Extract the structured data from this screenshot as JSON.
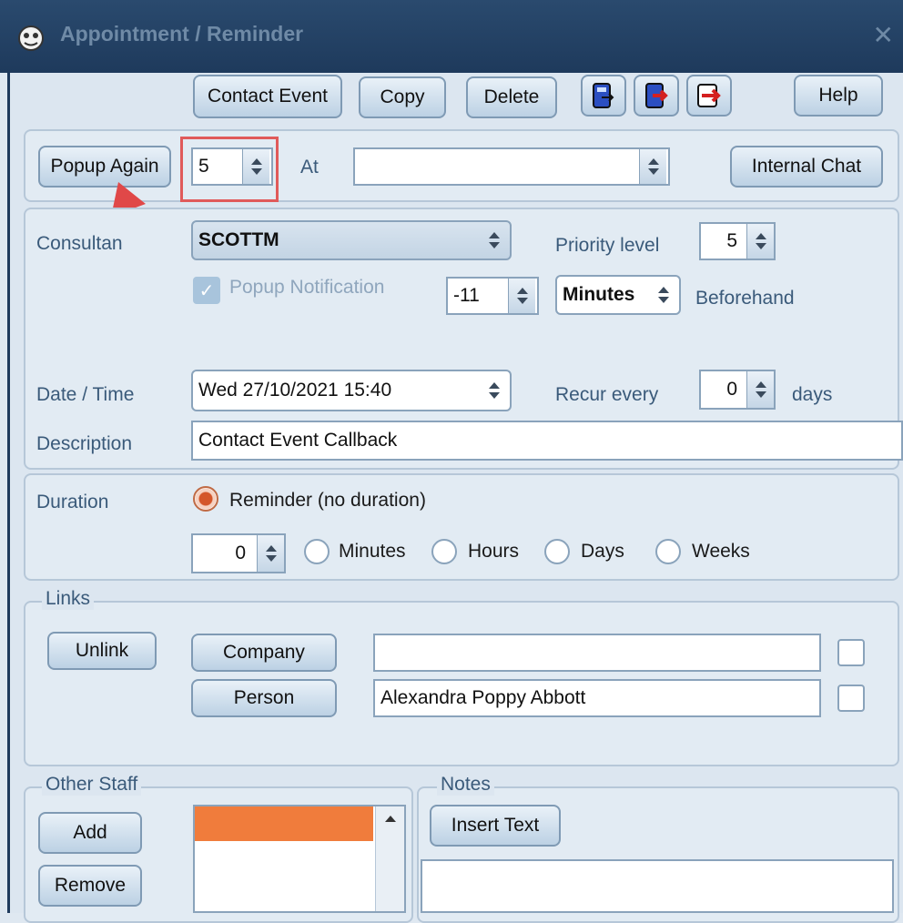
{
  "window": {
    "title": "Appointment / Reminder"
  },
  "toolbar": {
    "contact_event": "Contact Event",
    "copy": "Copy",
    "delete": "Delete",
    "help": "Help"
  },
  "popup": {
    "popup_again": "Popup Again",
    "count_value": "5",
    "at_label": "At",
    "at_value": "",
    "internal_chat": "Internal Chat"
  },
  "details": {
    "consultant_label": "Consultan",
    "consultant_value": "SCOTTM",
    "priority_label": "Priority level",
    "priority_value": "5",
    "popup_notification": "Popup Notification",
    "notify_value": "-11",
    "notify_unit": "Minutes",
    "beforehand": "Beforehand",
    "datetime_label": "Date / Time",
    "datetime_value": "Wed 27/10/2021 15:40",
    "recur_label": "Recur every",
    "recur_value": "0",
    "recur_unit": "days",
    "description_label": "Description",
    "description_value": "Contact Event Callback"
  },
  "duration": {
    "label": "Duration",
    "reminder_option": "Reminder (no duration)",
    "amount": "0",
    "minutes": "Minutes",
    "hours": "Hours",
    "days": "Days",
    "weeks": "Weeks"
  },
  "links": {
    "legend": "Links",
    "unlink": "Unlink",
    "company": "Company",
    "company_value": "",
    "person": "Person",
    "person_value": "Alexandra Poppy Abbott"
  },
  "other_staff": {
    "legend": "Other Staff",
    "add": "Add",
    "remove": "Remove"
  },
  "notes": {
    "legend": "Notes",
    "insert_text": "Insert Text"
  },
  "colors": {
    "highlight": "#e05a5a",
    "accent": "#d4562a"
  }
}
